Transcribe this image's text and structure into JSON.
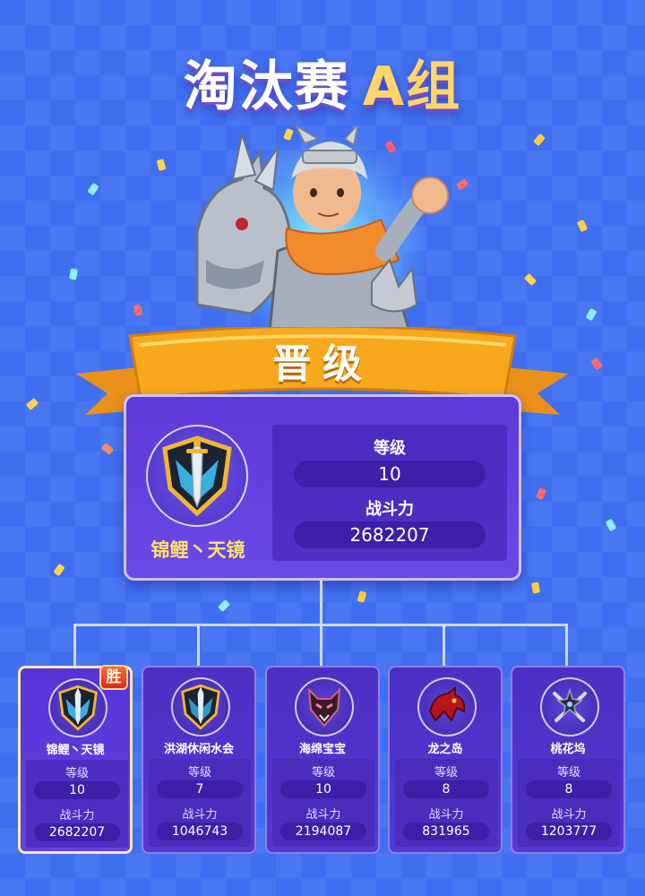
{
  "title": {
    "main": "淘汰赛",
    "group": "A组"
  },
  "banner": {
    "label": "晋级"
  },
  "winner": {
    "name": "锦鲤丶天镜",
    "level_label": "等级",
    "level": "10",
    "power_label": "战斗力",
    "power": "2682207",
    "emblem_icon": "sword-shield-emblem-icon"
  },
  "participants": [
    {
      "name": "锦鲤丶天镜",
      "level_label": "等级",
      "level": "10",
      "power_label": "战斗力",
      "power": "2682207",
      "badge": "胜",
      "emblem_icon": "sword-shield-emblem-icon"
    },
    {
      "name": "洪湖休闲水会",
      "level_label": "等级",
      "level": "7",
      "power_label": "战斗力",
      "power": "1046743",
      "emblem_icon": "sword-shield-emblem-icon"
    },
    {
      "name": "海绵宝宝",
      "level_label": "等级",
      "level": "10",
      "power_label": "战斗力",
      "power": "2194087",
      "emblem_icon": "wolf-emblem-icon"
    },
    {
      "name": "龙之岛",
      "level_label": "等级",
      "level": "8",
      "power_label": "战斗力",
      "power": "831965",
      "emblem_icon": "dragon-emblem-icon"
    },
    {
      "name": "桃花坞",
      "level_label": "等级",
      "level": "8",
      "power_label": "战斗力",
      "power": "1203777",
      "emblem_icon": "crossed-swords-emblem-icon"
    }
  ],
  "colors": {
    "background": "#3f6ff0",
    "card": "#5a3ad6",
    "pill": "#3d1fa8",
    "winner_name": "#ffe16b",
    "ribbon": "#f7a21b",
    "badge": "#e0331f"
  }
}
